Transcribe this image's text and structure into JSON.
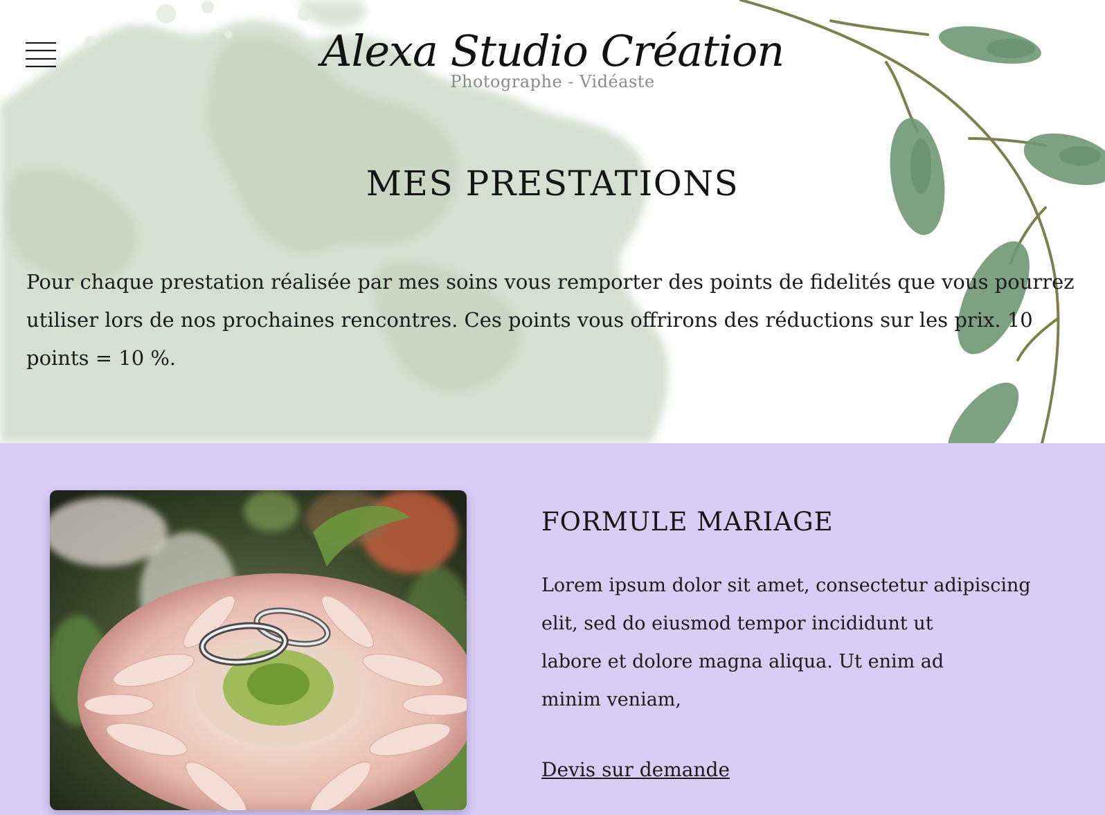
{
  "header": {
    "menu_icon": "hamburger-menu-icon",
    "site_title": "Alexa Studio Création",
    "site_subtitle": "Photographe - Vidéaste"
  },
  "hero": {
    "page_title": "MES PRESTATIONS",
    "intro_text": "Pour chaque prestation réalisée par mes soins vous remporter des points de fidelités que vous pourrez utiliser lors de nos prochaines rencontres. Ces points vous offrirons des réductions sur les prix.  10 points = 10 %."
  },
  "offer": {
    "title": "FORMULE MARIAGE",
    "description_lines": [
      "Lorem ipsum dolor sit amet, consectetur adipiscing",
      " elit, sed do eiusmod tempor incididunt ut",
      "labore et dolore magna aliqua. Ut enim ad",
      "minim veniam,"
    ],
    "link_label": "Devis sur demande",
    "image_icon": "wedding-rings-flower-photo"
  },
  "colors": {
    "offer_background": "#d7cdf5",
    "watercolor_green": "#c9d6c1",
    "leaf_green": "#5f8a63"
  }
}
